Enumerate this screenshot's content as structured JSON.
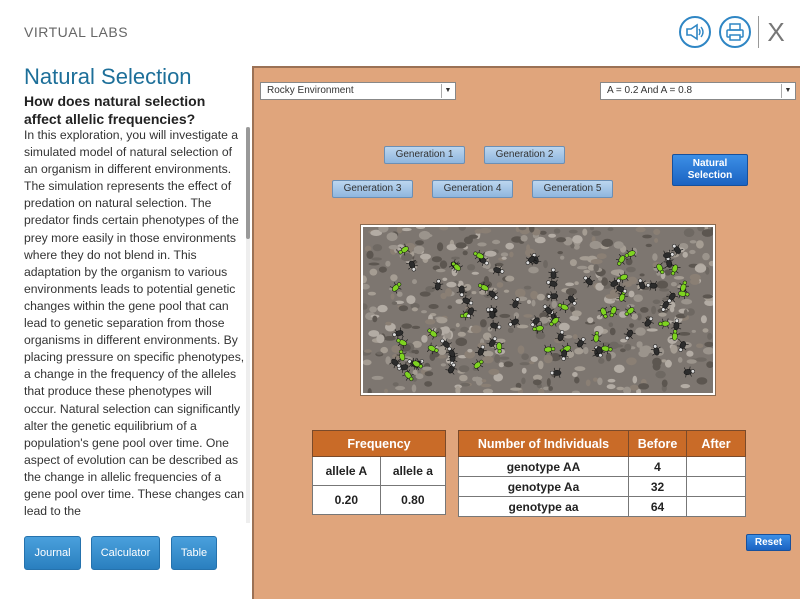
{
  "header": {
    "app_title": "VIRTUAL LABS",
    "audio_icon": "speaker-icon",
    "print_icon": "printer-icon",
    "close_label": "X"
  },
  "left": {
    "title": "Natural Selection",
    "question": "How does natural selection affect allelic frequencies?",
    "body": "In this exploration, you will investigate a simulated model of natural selection of an organism in different environments. The simulation represents the effect of predation on natural selection. The predator finds certain phenotypes of the prey more easily in those environments where they do not blend in. This adaptation by the organism to various environments leads to potential genetic changes within the gene pool that can lead to genetic separation from those organisms in different environments. By placing pressure on specific phenotypes, a change in the frequency of the alleles that produce these phenotypes will occur. Natural selection can significantly alter the genetic equilibrium of a population's gene pool over time. One aspect of evolution can be described as the change in allelic frequencies of a gene pool over time. These changes can lead to the",
    "buttons": {
      "journal": "Journal",
      "calculator": "Calculator",
      "table": "Table"
    }
  },
  "lab": {
    "environment_select": "Rocky Environment",
    "frequency_select": "A = 0.2 And A = 0.8",
    "generations": [
      "Generation 1",
      "Generation 2",
      "Generation 3",
      "Generation 4",
      "Generation 5"
    ],
    "natural_selection": "Natural Selection",
    "reset": "Reset",
    "frequency_table": {
      "title": "Frequency",
      "col_a": "allele A",
      "col_b": "allele a",
      "val_a": "0.20",
      "val_b": "0.80"
    },
    "individuals_table": {
      "headers": [
        "Number of Individuals",
        "Before",
        "After"
      ],
      "rows": [
        {
          "label": "genotype AA",
          "before": "4",
          "after": ""
        },
        {
          "label": "genotype Aa",
          "before": "32",
          "after": ""
        },
        {
          "label": "genotype aa",
          "before": "64",
          "after": ""
        }
      ]
    },
    "colors": {
      "panel": "#e0a57c",
      "table_header": "#c96b28",
      "green_bug": "#7ed321",
      "dark_bug": "#2c2c2c"
    }
  }
}
